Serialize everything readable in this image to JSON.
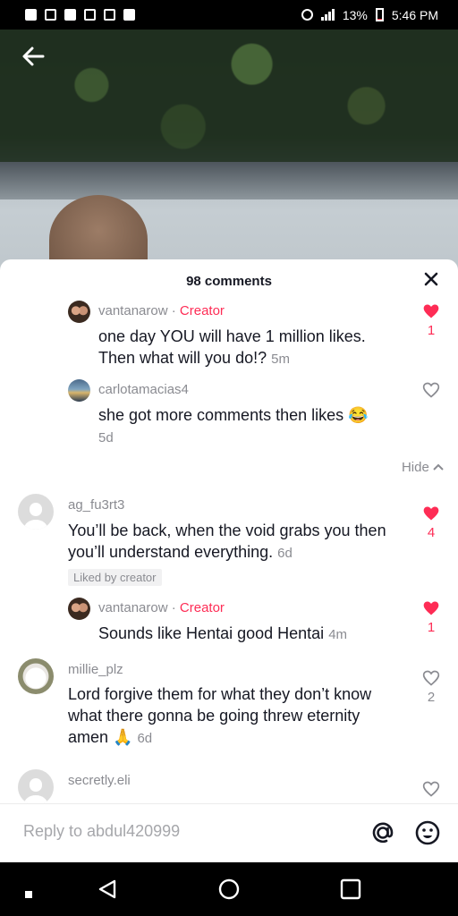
{
  "status_bar": {
    "battery": "13%",
    "time": "5:46 PM"
  },
  "sheet": {
    "title": "98 comments"
  },
  "comments": [
    {
      "username": "vantanarow",
      "creator_label": "Creator",
      "text": "one day YOU will have 1 million likes. Then what will you do!?",
      "time": "5m",
      "likes": "1",
      "liked": true
    },
    {
      "username": "carlotamacias4",
      "text": "she got more comments then likes 😂",
      "time": "5d",
      "likes": "",
      "liked": false
    },
    {
      "hide_label": "Hide"
    },
    {
      "username": "ag_fu3rt3",
      "text": "You’ll be back, when the void grabs you then you’ll understand everything.",
      "time": "6d",
      "liked_by": "Liked by creator",
      "likes": "4",
      "liked": true
    },
    {
      "username": "vantanarow",
      "creator_label": "Creator",
      "text": "Sounds like Hentai good Hentai",
      "time": "4m",
      "likes": "1",
      "liked": true
    },
    {
      "username": "millie_plz",
      "text": "Lord forgive them for what they don’t know what there gonna be going threw eternity amen 🙏",
      "time": "6d",
      "likes": "2",
      "liked": false
    },
    {
      "username": "secretly.eli",
      "likes": "",
      "liked": false
    }
  ],
  "reply": {
    "placeholder": "Reply to abdul420999"
  },
  "icons": {
    "back": "back-arrow-icon",
    "close": "close-icon",
    "heart": "heart-icon",
    "at": "at-mention-icon",
    "emoji": "emoji-icon"
  },
  "colors": {
    "accent": "#fe2c55",
    "text": "#161823",
    "muted": "#8a8b91"
  }
}
